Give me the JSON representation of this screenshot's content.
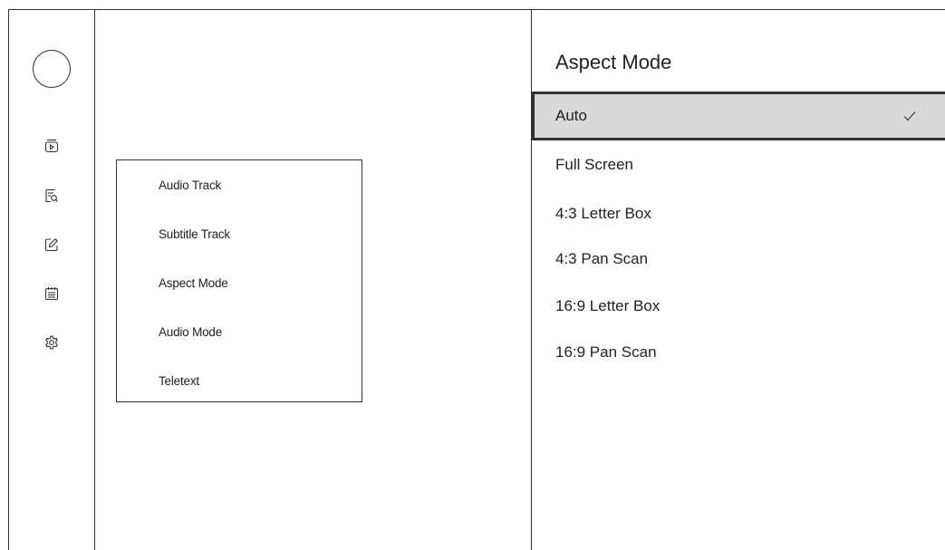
{
  "sidebar": {
    "avatar_icon": "user-avatar-circle",
    "nav": [
      {
        "name": "play-video-icon"
      },
      {
        "name": "search-document-icon"
      },
      {
        "name": "edit-icon"
      },
      {
        "name": "guide-calendar-icon"
      },
      {
        "name": "settings-gear-icon"
      }
    ]
  },
  "menu": {
    "items": [
      {
        "label": "Audio Track"
      },
      {
        "label": "Subtitle Track"
      },
      {
        "label": "Aspect Mode"
      },
      {
        "label": "Audio Mode"
      },
      {
        "label": "Teletext"
      }
    ]
  },
  "panel": {
    "title": "Aspect Mode",
    "selected_index": 0,
    "check_icon": "checkmark-icon",
    "options": [
      {
        "label": "Auto"
      },
      {
        "label": "Full Screen"
      },
      {
        "label": "4:3 Letter Box"
      },
      {
        "label": "4:3 Pan Scan"
      },
      {
        "label": "16:9 Letter Box"
      },
      {
        "label": "16:9 Pan Scan"
      }
    ]
  },
  "colors": {
    "line": "#333333",
    "selected_bg": "#d9d9d9",
    "text": "#222222"
  }
}
